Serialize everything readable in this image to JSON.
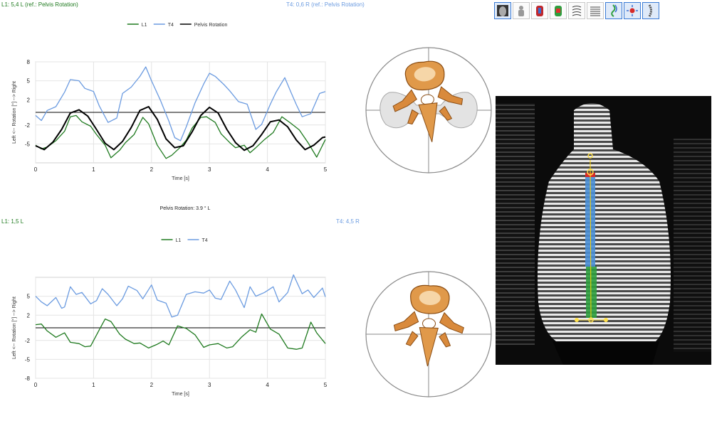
{
  "top_panel": {
    "left_header": "L1: 5,4 L (ref.: Pelvis Rotation)",
    "right_header": "T4: 0,6 R (ref.: Pelvis Rotation)"
  },
  "mid_label": "Pelvis Rotation: 3.9 ° L",
  "bottom_panel": {
    "left_header": "L1: 1,5 L",
    "right_header": "T4: 4,5 R"
  },
  "toolbar": {
    "icons": [
      "back-view-icon",
      "posture-icon",
      "color-map-icon",
      "surface-map-icon",
      "contour-icon",
      "lines-icon",
      "spine-curve-icon",
      "target-icon",
      "vertebra-column-icon"
    ]
  },
  "colors": {
    "l1": "#1f7a1f",
    "t4": "#6b9be0",
    "pelvis": "#000000"
  },
  "chart_data": [
    {
      "type": "line",
      "title": "",
      "xlabel": "Time [s]",
      "ylabel": "Left <-- Rotation [°] --> Right",
      "xlim": [
        0,
        5
      ],
      "ylim": [
        -8,
        8
      ],
      "yticks": [
        8,
        5,
        2,
        -2,
        -5
      ],
      "xticks": [
        0,
        1,
        2,
        3,
        4,
        5
      ],
      "legend": "top-center",
      "series": [
        {
          "name": "L1",
          "color": "#1f7a1f",
          "x": [
            0,
            0.1,
            0.2,
            0.35,
            0.5,
            0.6,
            0.7,
            0.8,
            0.95,
            1.05,
            1.2,
            1.3,
            1.45,
            1.55,
            1.7,
            1.85,
            1.95,
            2.1,
            2.25,
            2.35,
            2.5,
            2.6,
            2.7,
            2.85,
            2.95,
            3.1,
            3.2,
            3.35,
            3.45,
            3.6,
            3.7,
            3.8,
            3.95,
            4.1,
            4.25,
            4.4,
            4.55,
            4.7,
            4.85,
            5
          ],
          "values": [
            -5.2,
            -5.8,
            -5.5,
            -4.5,
            -3,
            -0.7,
            -0.5,
            -1.5,
            -2.2,
            -3.5,
            -5.2,
            -7.2,
            -6,
            -4.8,
            -3.5,
            -0.8,
            -1.8,
            -5.2,
            -7.3,
            -6.8,
            -5.5,
            -4.4,
            -2.5,
            -0.8,
            -0.7,
            -1.6,
            -3.4,
            -4.8,
            -5.6,
            -5.2,
            -6.4,
            -5.6,
            -4.3,
            -3.2,
            -0.7,
            -1.7,
            -2.8,
            -4.8,
            -7.1,
            -4.3
          ]
        },
        {
          "name": "T4",
          "color": "#6b9be0",
          "x": [
            0,
            0.1,
            0.2,
            0.35,
            0.5,
            0.6,
            0.75,
            0.85,
            1.0,
            1.1,
            1.25,
            1.4,
            1.5,
            1.65,
            1.8,
            1.9,
            2.0,
            2.15,
            2.3,
            2.4,
            2.5,
            2.6,
            2.75,
            2.9,
            3.0,
            3.1,
            3.25,
            3.35,
            3.5,
            3.65,
            3.8,
            3.9,
            4.05,
            4.15,
            4.3,
            4.4,
            4.5,
            4.6,
            4.75,
            4.9,
            5
          ],
          "values": [
            -0.5,
            -1.3,
            0.3,
            0.9,
            3.2,
            5.2,
            5.0,
            3.8,
            3.3,
            1,
            -1.6,
            -0.9,
            3,
            4,
            5.7,
            7.2,
            5,
            2,
            -1.4,
            -4,
            -4.5,
            -2.3,
            1.5,
            4.5,
            6.2,
            5.7,
            4.4,
            3.4,
            1.7,
            1.3,
            -2.7,
            -1.9,
            1.3,
            3.2,
            5.5,
            3.3,
            1.2,
            -0.7,
            -0.2,
            3,
            3.3
          ]
        },
        {
          "name": "Pelvis Rotation",
          "color": "#000000",
          "x": [
            0,
            0.15,
            0.3,
            0.45,
            0.6,
            0.75,
            0.9,
            1.05,
            1.2,
            1.35,
            1.5,
            1.65,
            1.8,
            1.95,
            2.1,
            2.25,
            2.4,
            2.55,
            2.7,
            2.85,
            3.0,
            3.15,
            3.3,
            3.45,
            3.6,
            3.75,
            3.9,
            4.05,
            4.2,
            4.35,
            4.5,
            4.65,
            4.8,
            4.95,
            5
          ],
          "values": [
            -5.3,
            -5.9,
            -4.7,
            -2.7,
            -0.1,
            0.4,
            -0.6,
            -2.7,
            -4.9,
            -5.9,
            -4.6,
            -2.4,
            0.3,
            0.9,
            -1.1,
            -4.2,
            -5.6,
            -5.3,
            -3.1,
            -0.5,
            0.8,
            -0.1,
            -2.7,
            -4.8,
            -6,
            -5.3,
            -3.5,
            -1.5,
            -1.2,
            -2.3,
            -4.4,
            -5.9,
            -5.2,
            -4,
            -3.9
          ]
        }
      ]
    },
    {
      "type": "line",
      "title": "",
      "xlabel": "Time [s]",
      "ylabel": "Left <-- Rotation [°] --> Right",
      "xlim": [
        0,
        5
      ],
      "ylim": [
        -8,
        8
      ],
      "yticks": [
        5,
        2,
        -2,
        -5,
        -8
      ],
      "xticks": [
        0,
        1,
        2,
        3,
        4,
        5
      ],
      "legend": "top-center",
      "series": [
        {
          "name": "L1",
          "color": "#1f7a1f",
          "x": [
            0,
            0.1,
            0.2,
            0.35,
            0.5,
            0.6,
            0.75,
            0.85,
            0.95,
            1.1,
            1.2,
            1.3,
            1.45,
            1.55,
            1.7,
            1.8,
            1.95,
            2.1,
            2.2,
            2.3,
            2.45,
            2.6,
            2.75,
            2.9,
            3.0,
            3.15,
            3.3,
            3.4,
            3.55,
            3.7,
            3.8,
            3.9,
            4.05,
            4.2,
            4.35,
            4.5,
            4.6,
            4.75,
            4.85,
            5
          ],
          "values": [
            0.5,
            0.6,
            -0.5,
            -1.5,
            -0.8,
            -2.3,
            -2.5,
            -3,
            -2.9,
            -0.3,
            1.4,
            1,
            -1,
            -1.8,
            -2.5,
            -2.4,
            -3.2,
            -2.6,
            -2.1,
            -2.7,
            0.3,
            -0.1,
            -1.1,
            -3.1,
            -2.7,
            -2.5,
            -3.2,
            -3,
            -1.5,
            -0.3,
            -0.7,
            2.2,
            -0.2,
            -1,
            -3.2,
            -3.4,
            -3.2,
            0.9,
            -0.8,
            -2.5
          ]
        },
        {
          "name": "T4",
          "color": "#6b9be0",
          "x": [
            0,
            0.1,
            0.2,
            0.35,
            0.45,
            0.5,
            0.6,
            0.7,
            0.8,
            0.95,
            1.05,
            1.15,
            1.25,
            1.4,
            1.5,
            1.6,
            1.75,
            1.85,
            2.0,
            2.1,
            2.25,
            2.35,
            2.45,
            2.6,
            2.75,
            2.9,
            3.0,
            3.1,
            3.2,
            3.35,
            3.45,
            3.6,
            3.7,
            3.8,
            3.95,
            4.1,
            4.2,
            4.35,
            4.45,
            4.6,
            4.7,
            4.8,
            4.95,
            5
          ],
          "values": [
            5,
            4.1,
            3.5,
            4.8,
            3.1,
            3.3,
            6.5,
            5.3,
            5.6,
            3.8,
            4.3,
            6.2,
            5.3,
            3.5,
            4.6,
            6.6,
            5.9,
            4.6,
            6.8,
            4.4,
            3.9,
            1.7,
            2,
            5.3,
            5.7,
            5.5,
            6,
            4.7,
            4.5,
            7.4,
            6,
            3.2,
            6.5,
            5,
            5.6,
            6.5,
            4.1,
            5.6,
            8.4,
            5.4,
            6,
            4.8,
            6.3,
            4.9
          ]
        }
      ]
    }
  ]
}
